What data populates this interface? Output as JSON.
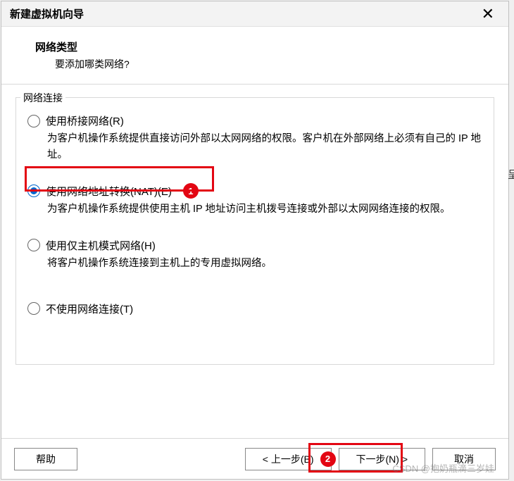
{
  "dialog": {
    "title": "新建虚拟机向导"
  },
  "header": {
    "title": "网络类型",
    "subtitle": "要添加哪类网络?"
  },
  "group": {
    "legend": "网络连接"
  },
  "options": {
    "bridged": {
      "label": "使用桥接网络(R)",
      "desc": "为客户机操作系统提供直接访问外部以太网网络的权限。客户机在外部网络上必须有自己的 IP 地址。"
    },
    "nat": {
      "label": "使用网络地址转换(NAT)(E)",
      "desc": "为客户机操作系统提供使用主机 IP 地址访问主机拨号连接或外部以太网网络连接的权限。"
    },
    "hostonly": {
      "label": "使用仅主机模式网络(H)",
      "desc": "将客户机操作系统连接到主机上的专用虚拟网络。"
    },
    "none": {
      "label": "不使用网络连接(T)"
    }
  },
  "annotations": {
    "badge1": "1",
    "badge2": "2"
  },
  "footer": {
    "help": "帮助",
    "back": "< 上一步(B)",
    "next": "下一步(N) >",
    "cancel": "取消"
  },
  "watermark": "CSDN @抱奶瓶滴三岁娃",
  "side_hint": "呈"
}
